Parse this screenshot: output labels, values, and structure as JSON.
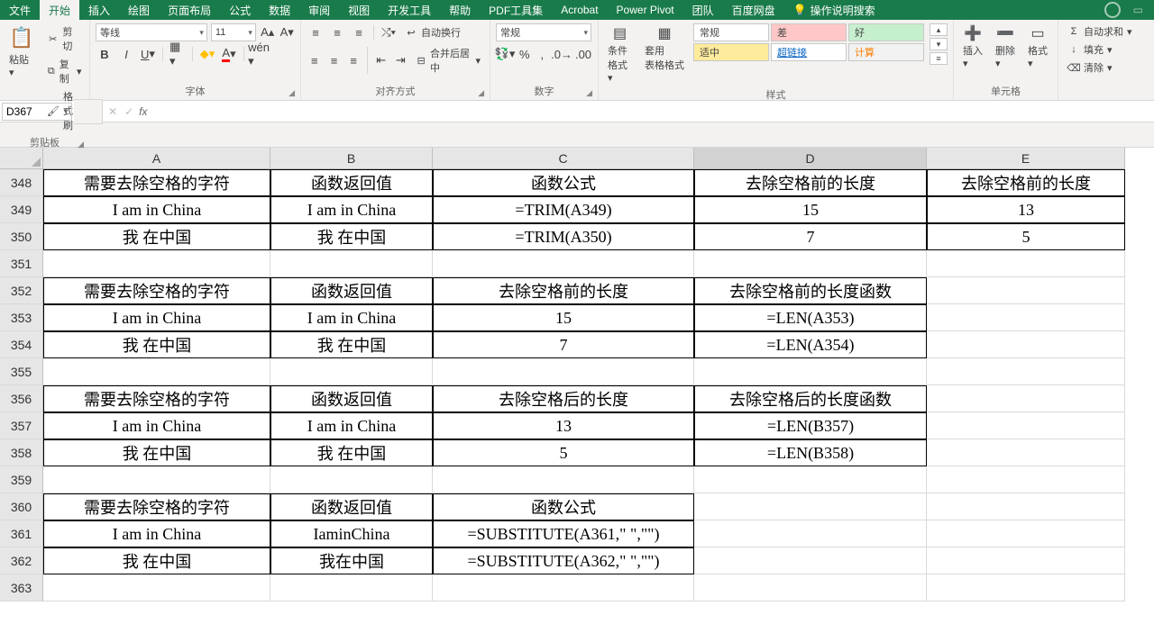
{
  "tabs": [
    "文件",
    "开始",
    "插入",
    "绘图",
    "页面布局",
    "公式",
    "数据",
    "审阅",
    "视图",
    "开发工具",
    "帮助",
    "PDF工具集",
    "Acrobat",
    "Power Pivot",
    "团队",
    "百度网盘"
  ],
  "active_tab_index": 1,
  "tell_me": "操作说明搜索",
  "ribbon": {
    "clipboard": {
      "paste": "粘贴",
      "cut": "剪切",
      "copy": "复制",
      "painter": "格式刷",
      "label": "剪贴板"
    },
    "font": {
      "name": "等线",
      "size": "11",
      "label": "字体"
    },
    "align": {
      "wrap": "自动换行",
      "merge": "合并后居中",
      "label": "对齐方式"
    },
    "number": {
      "format": "常规",
      "label": "数字"
    },
    "styles": {
      "cond": "条件格式",
      "table": "套用\n表格格式",
      "normal": "常规",
      "bad": "差",
      "good": "好",
      "neutral": "适中",
      "link": "超链接",
      "calc": "计算",
      "label": "样式"
    },
    "cells": {
      "insert": "插入",
      "delete": "删除",
      "format": "格式",
      "label": "单元格"
    },
    "editing": {
      "sum": "自动求和",
      "fill": "填充",
      "clear": "清除"
    }
  },
  "namebox": "D367",
  "columns": [
    "A",
    "B",
    "C",
    "D",
    "E"
  ],
  "rows": [
    {
      "n": 348,
      "cells": [
        "需要去除空格的字符",
        "函数返回值",
        "函数公式",
        "去除空格前的长度",
        "去除空格前的长度"
      ],
      "border": [
        1,
        1,
        1,
        1,
        1
      ]
    },
    {
      "n": 349,
      "cells": [
        "I am in China",
        "I am in China",
        "=TRIM(A349)",
        "15",
        "13"
      ],
      "border": [
        1,
        1,
        1,
        1,
        1
      ]
    },
    {
      "n": 350,
      "cells": [
        "我 在中国",
        "我 在中国",
        "=TRIM(A350)",
        "7",
        "5"
      ],
      "border": [
        1,
        1,
        1,
        1,
        1
      ]
    },
    {
      "n": 351,
      "cells": [
        "",
        "",
        "",
        "",
        ""
      ],
      "border": [
        0,
        0,
        0,
        0,
        0
      ]
    },
    {
      "n": 352,
      "cells": [
        "需要去除空格的字符",
        "函数返回值",
        "去除空格前的长度",
        "去除空格前的长度函数",
        ""
      ],
      "border": [
        1,
        1,
        1,
        1,
        0
      ]
    },
    {
      "n": 353,
      "cells": [
        "I am in China",
        "I am in China",
        "15",
        "=LEN(A353)",
        ""
      ],
      "border": [
        1,
        1,
        1,
        1,
        0
      ]
    },
    {
      "n": 354,
      "cells": [
        "我 在中国",
        "我 在中国",
        "7",
        "=LEN(A354)",
        ""
      ],
      "border": [
        1,
        1,
        1,
        1,
        0
      ]
    },
    {
      "n": 355,
      "cells": [
        "",
        "",
        "",
        "",
        ""
      ],
      "border": [
        0,
        0,
        0,
        0,
        0
      ]
    },
    {
      "n": 356,
      "cells": [
        "需要去除空格的字符",
        "函数返回值",
        "去除空格后的长度",
        "去除空格后的长度函数",
        ""
      ],
      "border": [
        1,
        1,
        1,
        1,
        0
      ]
    },
    {
      "n": 357,
      "cells": [
        "I am in China",
        "I am in China",
        "13",
        "=LEN(B357)",
        ""
      ],
      "border": [
        1,
        1,
        1,
        1,
        0
      ]
    },
    {
      "n": 358,
      "cells": [
        "我 在中国",
        "我 在中国",
        "5",
        "=LEN(B358)",
        ""
      ],
      "border": [
        1,
        1,
        1,
        1,
        0
      ]
    },
    {
      "n": 359,
      "cells": [
        "",
        "",
        "",
        "",
        ""
      ],
      "border": [
        0,
        0,
        0,
        0,
        0
      ]
    },
    {
      "n": 360,
      "cells": [
        "需要去除空格的字符",
        "函数返回值",
        "函数公式",
        "",
        ""
      ],
      "border": [
        1,
        1,
        1,
        0,
        0
      ]
    },
    {
      "n": 361,
      "cells": [
        "I am in China",
        "IaminChina",
        "=SUBSTITUTE(A361,\" \",\"\")",
        "",
        ""
      ],
      "border": [
        1,
        1,
        1,
        0,
        0
      ]
    },
    {
      "n": 362,
      "cells": [
        "我 在中国",
        "我在中国",
        "=SUBSTITUTE(A362,\" \",\"\")",
        "",
        ""
      ],
      "border": [
        1,
        1,
        1,
        0,
        0
      ]
    },
    {
      "n": 363,
      "cells": [
        "",
        "",
        "",
        "",
        ""
      ],
      "border": [
        0,
        0,
        0,
        0,
        0
      ]
    }
  ]
}
